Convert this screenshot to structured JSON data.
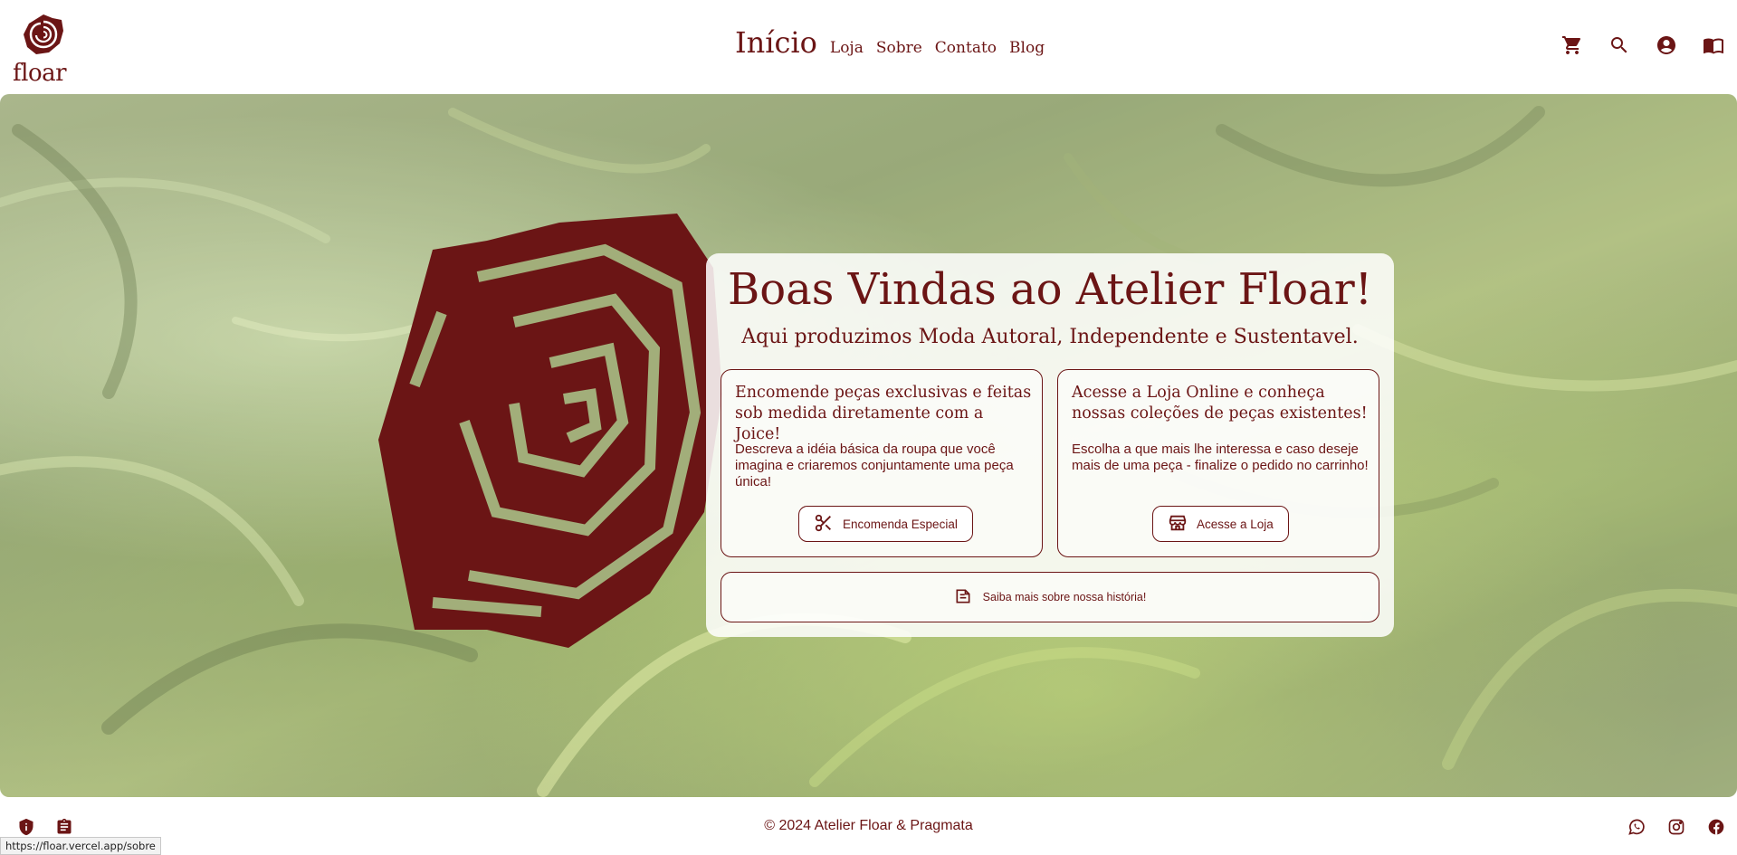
{
  "brand": {
    "logo_text": "floar",
    "accent": "#6b1515"
  },
  "nav": {
    "items": [
      {
        "label": "Início",
        "active": true
      },
      {
        "label": "Loja",
        "active": false
      },
      {
        "label": "Sobre",
        "active": false
      },
      {
        "label": "Contato",
        "active": false
      },
      {
        "label": "Blog",
        "active": false
      }
    ]
  },
  "header_icons": [
    "cart-icon",
    "search-icon",
    "account-icon",
    "book-icon"
  ],
  "hero": {
    "title": "Boas Vindas ao Atelier Floar!",
    "subtitle": "Aqui produzimos Moda Autoral, Independente e Sustentavel.",
    "cards": [
      {
        "title": "Encomende peças exclusivas e feitas sob medida diretamente com a Joice!",
        "text": "Descreva a idéia básica da roupa que você imagina e criaremos conjuntamente uma peça única!",
        "button_label": "Encomenda Especial",
        "button_icon": "scissors-icon"
      },
      {
        "title": "Acesse a Loja Online e conheça nossas coleções de peças existentes!",
        "text": "Escolha a que mais lhe interessa e caso deseje mais de uma peça - finalize o pedido no carrinho!",
        "button_label": "Acesse a Loja",
        "button_icon": "store-icon"
      }
    ],
    "history_label": "Saiba mais sobre nossa história!",
    "history_icon": "history-icon"
  },
  "footer": {
    "left_icons": [
      "privacy-shield-icon",
      "terms-clipboard-icon"
    ],
    "copyright": "© 2024 Atelier Floar & Pragmata",
    "social_icons": [
      "whatsapp-icon",
      "instagram-icon",
      "facebook-icon"
    ]
  },
  "status_bar": {
    "url": "https://floar.vercel.app/sobre"
  }
}
